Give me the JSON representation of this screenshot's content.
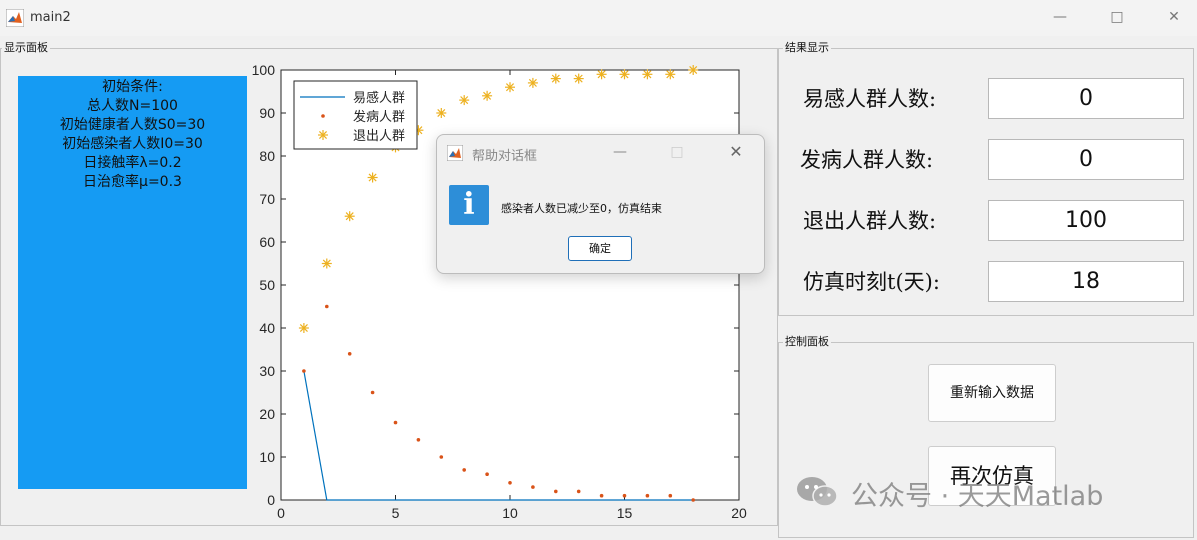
{
  "window": {
    "title": "main2"
  },
  "display_panel": {
    "title": "显示面板",
    "conditions": [
      "初始条件:",
      "总人数N=100",
      "初始健康者人数S0=30",
      "初始感染者人数I0=30",
      "日接触率λ=0.2",
      "日治愈率μ=0.3"
    ],
    "box_color": "#159bf3"
  },
  "chart_data": {
    "type": "line",
    "xlim": [
      0,
      20
    ],
    "ylim": [
      0,
      100
    ],
    "xticks": [
      "0",
      "5",
      "10",
      "15",
      "20"
    ],
    "yticks": [
      "0",
      "10",
      "20",
      "30",
      "40",
      "50",
      "60",
      "70",
      "80",
      "90",
      "100"
    ],
    "legend_position": "top-left",
    "series": [
      {
        "name": "易感人群",
        "style": "line",
        "color": "#0072bd",
        "x": [
          1,
          2,
          18
        ],
        "y": [
          30,
          0,
          0
        ]
      },
      {
        "name": "发病人群",
        "style": "dot",
        "color": "#d95319",
        "x": [
          1,
          2,
          3,
          4,
          5,
          6,
          7,
          8,
          9,
          10,
          11,
          12,
          13,
          14,
          15,
          16,
          17,
          18
        ],
        "y": [
          30,
          45,
          34,
          25,
          18,
          14,
          10,
          7,
          6,
          4,
          3,
          2,
          2,
          1,
          1,
          1,
          1,
          0
        ]
      },
      {
        "name": "退出人群",
        "style": "star",
        "color": "#edb120",
        "x": [
          1,
          2,
          3,
          4,
          5,
          6,
          7,
          8,
          9,
          10,
          11,
          12,
          13,
          14,
          15,
          16,
          17,
          18
        ],
        "y": [
          40,
          55,
          66,
          75,
          82,
          86,
          90,
          93,
          94,
          96,
          97,
          98,
          98,
          99,
          99,
          99,
          99,
          100
        ]
      }
    ]
  },
  "results_panel": {
    "title": "结果显示",
    "rows": [
      {
        "label": "易感人群人数:",
        "value": "0"
      },
      {
        "label": "发病人群人数:",
        "value": "0"
      },
      {
        "label": "退出人群人数:",
        "value": "100"
      },
      {
        "label": "仿真时刻t(天):",
        "value": "18"
      }
    ]
  },
  "control_panel": {
    "title": "控制面板",
    "reinput_label": "重新输入数据",
    "rerun_label": "再次仿真"
  },
  "dialog": {
    "title": "帮助对话框",
    "message": "感染者人数已减少至0，仿真结束",
    "ok_label": "确定"
  },
  "watermark": {
    "text": "公众号 · 天天Matlab"
  }
}
